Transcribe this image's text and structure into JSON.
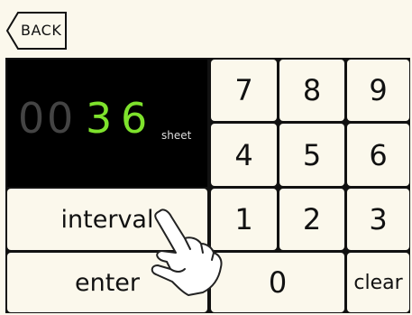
{
  "back": {
    "label": "BACK"
  },
  "display": {
    "leading_digits": [
      "0",
      "0"
    ],
    "value_digits": [
      "3",
      "6"
    ],
    "unit": "sheet"
  },
  "keys": {
    "7": "7",
    "8": "8",
    "9": "9",
    "4": "4",
    "5": "5",
    "6": "6",
    "1": "1",
    "2": "2",
    "3": "3",
    "0": "0",
    "interval": "interval",
    "enter": "enter",
    "clear": "clear"
  },
  "colors": {
    "background": "#fbf8ec",
    "display_digit": "#7ee22c",
    "display_dim": "#444444"
  }
}
